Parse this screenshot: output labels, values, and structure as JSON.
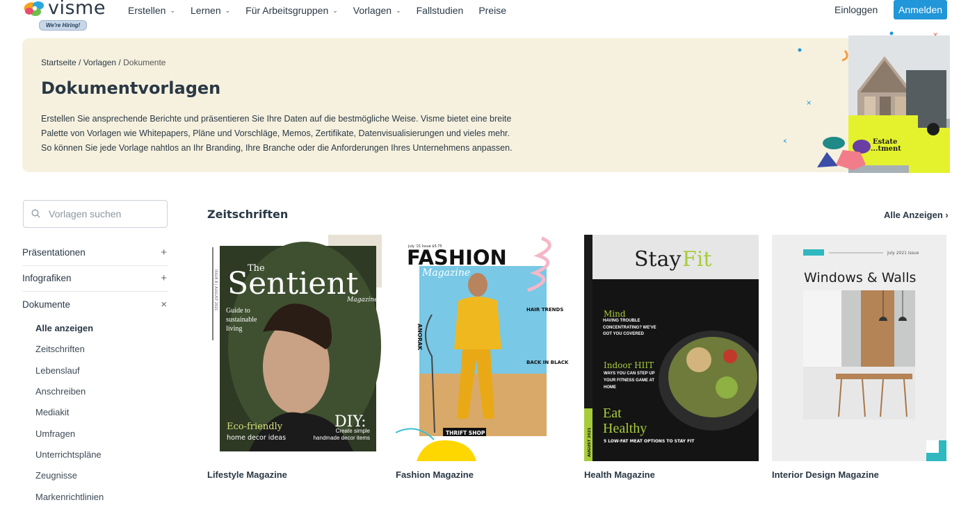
{
  "nav": {
    "logo_text": "visme",
    "hiring_badge": "We're Hiring!",
    "menu": [
      {
        "label": "Erstellen",
        "has_dropdown": true
      },
      {
        "label": "Lernen",
        "has_dropdown": true
      },
      {
        "label": "Für Arbeitsgruppen",
        "has_dropdown": true
      },
      {
        "label": "Vorlagen",
        "has_dropdown": true
      },
      {
        "label": "Fallstudien",
        "has_dropdown": false
      },
      {
        "label": "Preise",
        "has_dropdown": false
      }
    ],
    "login": "Einloggen",
    "register": "Anmelden",
    "accent_color": "#2196d8"
  },
  "hero": {
    "breadcrumb": {
      "home": "Startseite",
      "sep": " / ",
      "templates": "Vorlagen",
      "current": "Dokumente"
    },
    "title": "Dokumentvorlagen",
    "description": "Erstellen Sie ansprechende Berichte und präsentieren Sie Ihre Daten auf die bestmögliche Weise. Visme bietet eine breite Palette von Vorlagen wie Whitepapers, Pläne und Vorschläge, Memos, Zertifikate, Datenvisualisierungen und vieles mehr. So können Sie jede Vorlage nahtlos an Ihr Branding, Ihre Branche oder die Anforderungen Ihres Unternehmens anpassen.",
    "art_text": {
      "line1": "Estate",
      "line2": "...tment"
    }
  },
  "search": {
    "placeholder": "Vorlagen suchen",
    "value": ""
  },
  "sidebar": {
    "categories": [
      {
        "label": "Präsentationen",
        "toggle": "+"
      },
      {
        "label": "Infografiken",
        "toggle": "+"
      },
      {
        "label": "Dokumente",
        "toggle": "×"
      }
    ],
    "subitems": [
      "Alle anzeigen",
      "Zeitschriften",
      "Lebenslauf",
      "Anschreiben",
      "Mediakit",
      "Umfragen",
      "Unterrichtspläne",
      "Zeugnisse",
      "Markenrichtlinien"
    ],
    "active_subitem": "Alle anzeigen"
  },
  "section": {
    "title": "Zeitschriften",
    "see_all": "Alle Anzeigen"
  },
  "cards": [
    {
      "caption": "Lifestyle Magazine",
      "cover": {
        "the": "The",
        "title": "Sentient",
        "sub": "Magazine",
        "tagline": "Guide to sustainable living",
        "eco": "Eco-friendly",
        "eco_sub": "home decor ideas",
        "diy": "DIY:",
        "diy_sub": "Create simple handmade decor items",
        "issue": "ISSUE 8 | AUGUST 2021"
      }
    },
    {
      "caption": "Fashion Magazine",
      "cover": {
        "issue": "July '21 Issue  $5.75",
        "title": "FASHION",
        "sub": "Magazine",
        "side": "ANORAK",
        "hair": "HAIR TRENDS",
        "black": "BACK IN BLACK",
        "thrift": "THRIFT SHOP"
      }
    },
    {
      "caption": "Health Magazine",
      "cover": {
        "title_a": "Stay",
        "title_b": "Fit",
        "mind": "Mind",
        "mind_sub": "HAVING TROUBLE CONCENTRATING? WE'VE GOT YOU COVERED",
        "hiit": "Indoor HIIT",
        "hiit_sub": "WAYS YOU CAN STEP UP YOUR FITNESS GAME AT HOME",
        "eat": "Eat Healthy",
        "eat_sub": "5 LOW-FAT MEAT OPTIONS TO STAY FIT",
        "date": "AUGUST 2021"
      }
    },
    {
      "caption": "Interior Design Magazine",
      "cover": {
        "issue": "July 2021 Issue",
        "title": "Windows & Walls"
      }
    }
  ]
}
